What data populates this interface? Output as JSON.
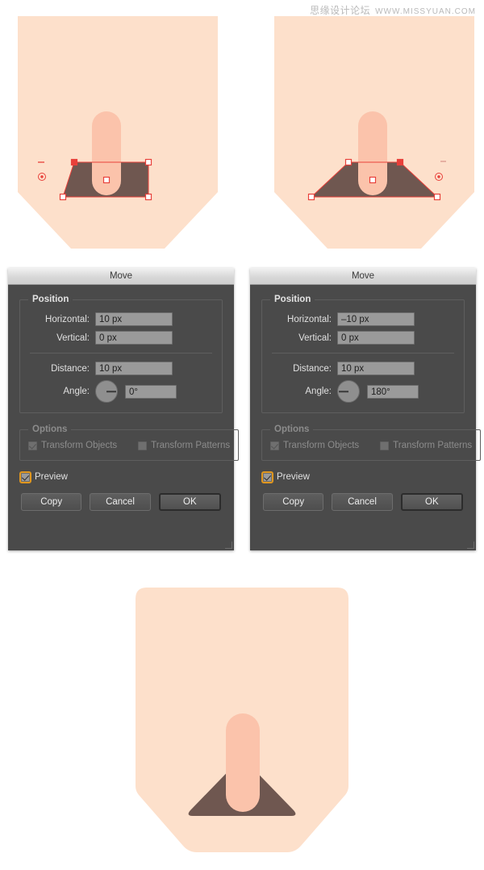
{
  "watermark": {
    "cn": "思缘设计论坛",
    "url": "WWW.MISSYUAN.COM"
  },
  "colors": {
    "skin": "#fde0cb",
    "nostril_light": "#fbc3ab",
    "brown": "#6f5750",
    "anchor": "#e8403a",
    "dialog_bg": "#4a4a4a",
    "titlebar": "#dcdcdc",
    "input_bg": "#9a9a9a",
    "preview_focus": "#e0971f",
    "page_bg": "#ffffff"
  },
  "artwork": {
    "step1": {
      "label": "nose-shape-before-move",
      "selected_shape": "trapezoid-right-aligned"
    },
    "step2": {
      "label": "nose-shape-after-move",
      "selected_shape": "symmetric-triangle"
    },
    "step3": {
      "label": "nose-shape-final",
      "selected_shape": "none"
    }
  },
  "dialogs": [
    {
      "title": "Move",
      "position_group_label": "Position",
      "fields": [
        {
          "label": "Horizontal:",
          "value": "10 px"
        },
        {
          "label": "Vertical:",
          "value": "0 px"
        },
        {
          "label": "Distance:",
          "value": "10 px"
        },
        {
          "label": "Angle:",
          "value": "0°"
        }
      ],
      "angle_degrees": 0,
      "options_group_label": "Options",
      "options": [
        {
          "label": "Transform Objects",
          "checked": true,
          "enabled": false
        },
        {
          "label": "Transform Patterns",
          "checked": false,
          "enabled": false
        }
      ],
      "preview": {
        "label": "Preview",
        "checked": true,
        "focused": true
      },
      "buttons": [
        {
          "label": "Copy",
          "default": false
        },
        {
          "label": "Cancel",
          "default": false
        },
        {
          "label": "OK",
          "default": true
        }
      ]
    },
    {
      "title": "Move",
      "position_group_label": "Position",
      "fields": [
        {
          "label": "Horizontal:",
          "value": "–10 px"
        },
        {
          "label": "Vertical:",
          "value": "0 px"
        },
        {
          "label": "Distance:",
          "value": "10 px"
        },
        {
          "label": "Angle:",
          "value": "180°"
        }
      ],
      "angle_degrees": 180,
      "options_group_label": "Options",
      "options": [
        {
          "label": "Transform Objects",
          "checked": true,
          "enabled": false
        },
        {
          "label": "Transform Patterns",
          "checked": false,
          "enabled": false
        }
      ],
      "preview": {
        "label": "Preview",
        "checked": true,
        "focused": true
      },
      "buttons": [
        {
          "label": "Copy",
          "default": false
        },
        {
          "label": "Cancel",
          "default": false
        },
        {
          "label": "OK",
          "default": true
        }
      ]
    }
  ]
}
